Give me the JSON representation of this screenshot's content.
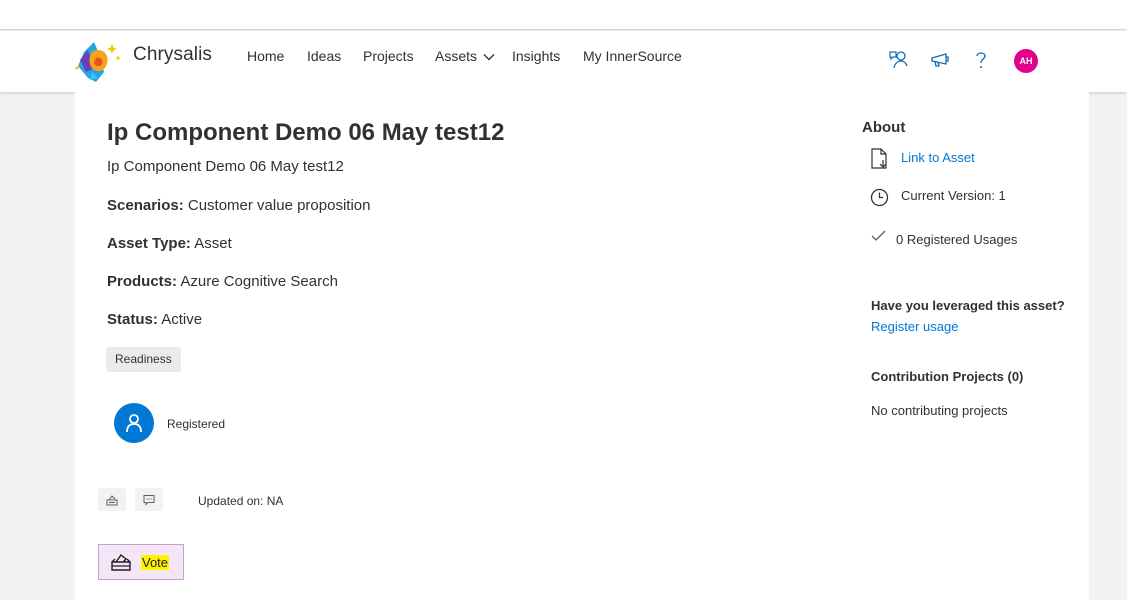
{
  "app": {
    "brand": "Chrysalis"
  },
  "nav": {
    "items": [
      {
        "label": "Home"
      },
      {
        "label": "Ideas"
      },
      {
        "label": "Projects"
      },
      {
        "label": "Assets"
      },
      {
        "label": "Insights"
      },
      {
        "label": "My InnerSource"
      }
    ]
  },
  "header": {
    "avatar_initials": "AH",
    "icons": [
      "feedback-icon",
      "announcement-icon",
      "help-icon"
    ],
    "avatar_color": "#e3008c"
  },
  "asset": {
    "title": "Ip Component Demo 06 May test12",
    "description": "Ip Component Demo 06 May test12",
    "fields": [
      {
        "label": "Scenarios:",
        "value": "Customer value proposition"
      },
      {
        "label": "Asset Type:",
        "value": "Asset"
      },
      {
        "label": "Products:",
        "value": "Azure Cognitive Search"
      },
      {
        "label": "Status:",
        "value": "Active"
      }
    ],
    "tag": "Readiness",
    "registered_label": "Registered",
    "updated_label": "Updated on:",
    "updated_value": "NA",
    "vote_label": "Vote"
  },
  "about": {
    "heading": "About",
    "link_to_asset": "Link to Asset",
    "current_version": "Current Version: 1",
    "registered_usages": "0 Registered Usages",
    "leverage_question": "Have you leveraged this asset?",
    "register_usage": "Register usage",
    "contribution_heading": "Contribution Projects (0)",
    "no_contributing": "No contributing projects"
  },
  "colors": {
    "accent": "#0078d4",
    "vote_highlight": "#fff200",
    "vote_bg": "#f5e6f7"
  }
}
